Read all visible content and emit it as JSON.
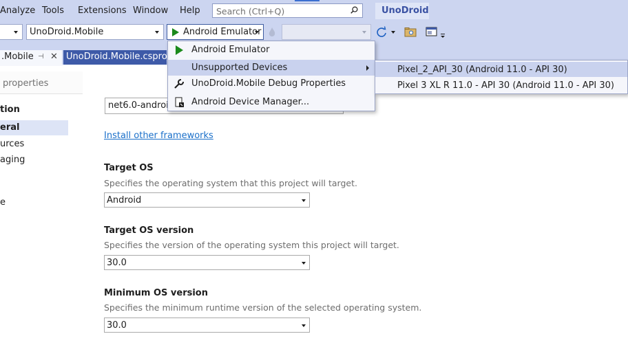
{
  "menubar": {
    "items": [
      "Analyze",
      "Tools",
      "Extensions",
      "Window",
      "Help"
    ],
    "search_placeholder": "Search (Ctrl+Q)",
    "app_title": "UnoDroid"
  },
  "toolbar": {
    "project_combo": "UnoDroid.Mobile",
    "run_target": "Android Emulator"
  },
  "tabs": [
    {
      "label": ".Mobile"
    },
    {
      "label": "UnoDroid.Mobile.csproj"
    }
  ],
  "nav": {
    "search_placeholder": "properties",
    "items": [
      "tion",
      "eral",
      "urces",
      "aging",
      "e"
    ]
  },
  "run_menu": {
    "items": [
      {
        "label": "Android Emulator",
        "icon": "play-icon"
      },
      {
        "label": "Unsupported Devices",
        "icon": ""
      },
      {
        "label": "UnoDroid.Mobile Debug Properties",
        "icon": "wrench-icon"
      },
      {
        "label": "Android Device Manager...",
        "icon": "device-manager-icon"
      }
    ],
    "submenu": [
      "Pixel_2_API_30 (Android 11.0 - API 30)",
      "Pixel 3 XL R 11.0 - API 30 (Android 11.0 - API 30)"
    ]
  },
  "content": {
    "framework_value": "net6.0-android",
    "install_link": "Install other frameworks",
    "target_os": {
      "heading": "Target OS",
      "description": "Specifies the operating system that this project will target.",
      "value": "Android"
    },
    "target_os_version": {
      "heading": "Target OS version",
      "description": "Specifies the version of the operating system this project will target.",
      "value": "30.0"
    },
    "min_os_version": {
      "heading": "Minimum OS version",
      "description": "Specifies the minimum runtime version of the selected operating system.",
      "value": "30.0"
    }
  },
  "colors": {
    "chrome": "#ccd5f0",
    "accent": "#3e5aa8",
    "highlight": "#c9d2ee",
    "link": "#1a6fc9",
    "play": "#1b8a1b"
  }
}
